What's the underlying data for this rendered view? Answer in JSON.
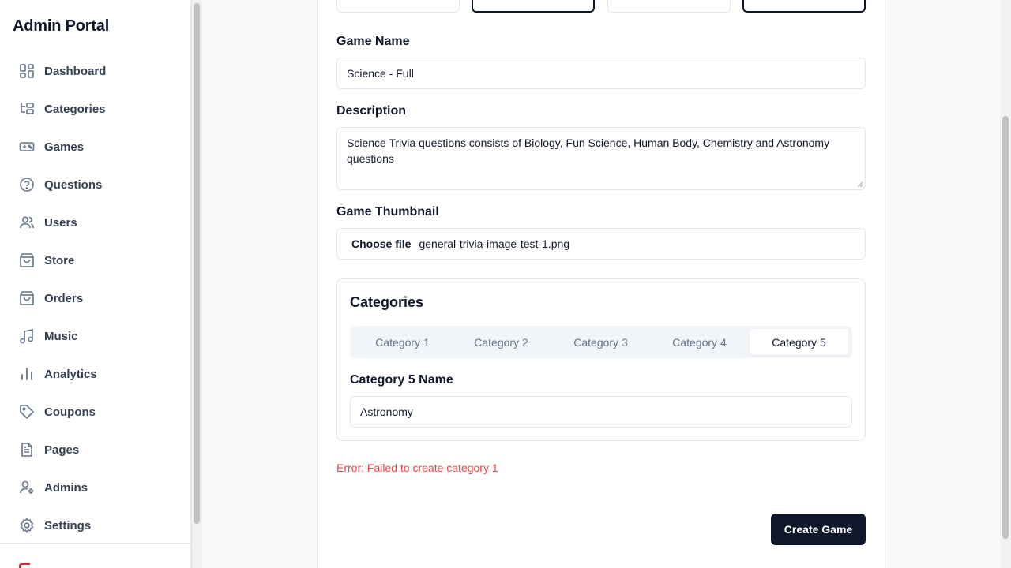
{
  "app": {
    "title": "Admin Portal"
  },
  "sidebar": {
    "items": [
      {
        "label": "Dashboard",
        "icon": "dashboard-icon"
      },
      {
        "label": "Categories",
        "icon": "categories-icon"
      },
      {
        "label": "Games",
        "icon": "gamepad-icon"
      },
      {
        "label": "Questions",
        "icon": "question-circle-icon"
      },
      {
        "label": "Users",
        "icon": "users-icon"
      },
      {
        "label": "Store",
        "icon": "shopping-bag-icon"
      },
      {
        "label": "Orders",
        "icon": "shopping-bag-icon"
      },
      {
        "label": "Music",
        "icon": "music-icon"
      },
      {
        "label": "Analytics",
        "icon": "bar-chart-icon"
      },
      {
        "label": "Coupons",
        "icon": "tag-icon"
      },
      {
        "label": "Pages",
        "icon": "file-text-icon"
      },
      {
        "label": "Admins",
        "icon": "user-cog-icon"
      },
      {
        "label": "Settings",
        "icon": "gear-icon"
      }
    ]
  },
  "form": {
    "game_name_label": "Game Name",
    "game_name_value": "Science - Full",
    "description_label": "Description",
    "description_value": "Science Trivia questions consists of Biology, Fun Science, Human Body, Chemistry and Astronomy questions",
    "thumbnail_label": "Game Thumbnail",
    "choose_file_label": "Choose file",
    "file_name": "general-trivia-image-test-1.png"
  },
  "categories": {
    "title": "Categories",
    "tabs": [
      "Category 1",
      "Category 2",
      "Category 3",
      "Category 4",
      "Category 5"
    ],
    "active_tab": "Category 5",
    "name_label": "Category 5 Name",
    "name_value": "Astronomy"
  },
  "error": "Error: Failed to create category 1",
  "create_button": "Create Game",
  "colors": {
    "primary": "#0f172a",
    "error": "#ef4444",
    "muted": "#64748b",
    "logout": "#dc2626"
  }
}
